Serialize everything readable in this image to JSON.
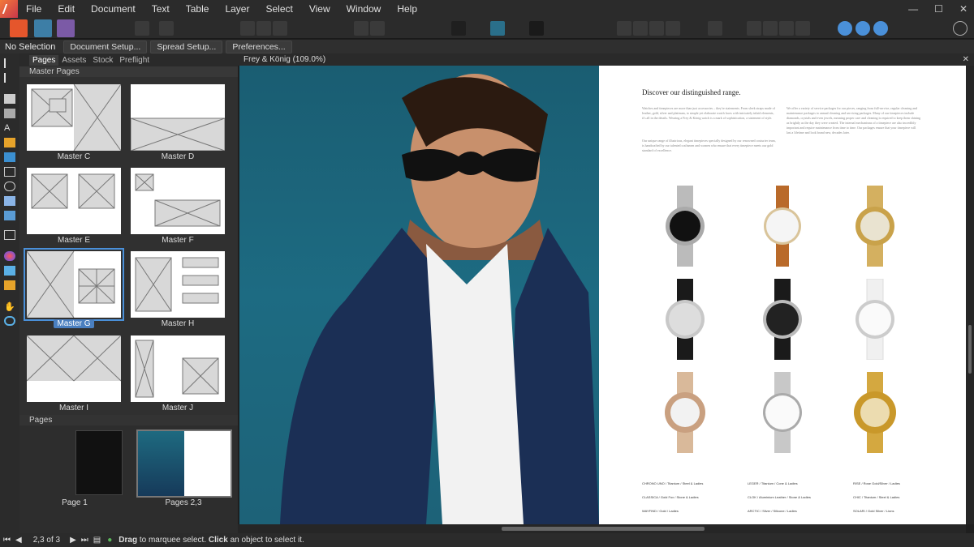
{
  "menu": [
    "File",
    "Edit",
    "Document",
    "Text",
    "Table",
    "Layer",
    "Select",
    "View",
    "Window",
    "Help"
  ],
  "window_controls": [
    "—",
    "☐",
    "✕"
  ],
  "context": {
    "selection": "No Selection",
    "buttons": [
      "Document Setup...",
      "Spread Setup...",
      "Preferences..."
    ]
  },
  "panel": {
    "tabs": [
      "Pages",
      "Assets",
      "Stock",
      "Preflight"
    ],
    "master_pages_title": "Master Pages",
    "masters": [
      "Master C",
      "Master D",
      "Master E",
      "Master F",
      "Master G",
      "Master H",
      "Master I",
      "Master J"
    ],
    "selected_master": "Master G",
    "pages_title": "Pages",
    "pages": [
      "Page 1",
      "Pages 2,3"
    ]
  },
  "document": {
    "tab_title": "Frey & König (109.0%)",
    "heading": "Discover our distinguished range.",
    "para1": "Watches and timepieces are more than just accessories – they're statements. From sleek straps made of leather, gold, silver and platinum, to simple yet elaborate watch faces with intricately inlaid elements, it's all in the details. Wearing a Frey & König watch is a mark of sophistication, a statement of style.",
    "para2": "Our unique range of illustrious, elegant timepieces specially designed by our renowned couturier team, is handcrafted by our talented craftsmen and women who ensure that every timepiece meets our gold standard of excellence.",
    "para3": "We offer a variety of service packages for our pieces, ranging from full-service, regular cleaning and maintenance packages to annual cleaning and servicing packages. Many of our timepieces include diamonds, crystals and even jewels, meaning proper care and cleaning is required to keep them shining as brightly as the day they were created. The internal mechanisms of a timepiece are also incredibly important and require maintenance from time to time. Our packages ensure that your timepiece will last a lifetime and look brand new, decades later.",
    "legend": [
      [
        "CHRONO UNO / Titanium / Steel & Ladies",
        "LEGER / Titanium / Cone & Ladies",
        "RISE / Rose Gold/Silver / Ladies"
      ],
      [
        "CLASSICA / Gold Fox / Stone & Ladies",
        "CLOK / Aluminium Leather / Stone & Ladies",
        "CHIC / Titanium / Steel & Ladies"
      ],
      [
        "WAYFIND / Gold / Ladies",
        "ARCTIC / Silver / Silicone / Ladies",
        "SOLARI / Gold Silver / Lions"
      ]
    ]
  },
  "status": {
    "page_indicator": "2,3 of 3",
    "hint_bold1": "Drag",
    "hint1": " to marquee select. ",
    "hint_bold2": "Click",
    "hint2": " an object to select it."
  }
}
